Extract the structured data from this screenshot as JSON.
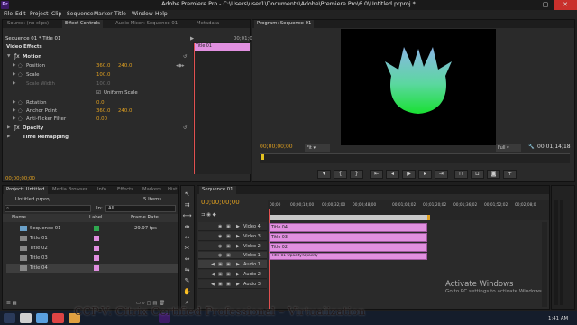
{
  "window": {
    "title": "Adobe Premiere Pro - C:\\Users\\user1\\Documents\\Adobe\\Premiere Pro\\6.0\\Untitled.prproj *"
  },
  "menu": [
    "File",
    "Edit",
    "Project",
    "Clip",
    "Sequence",
    "Marker",
    "Title",
    "Window",
    "Help"
  ],
  "source_panel": {
    "tabs": [
      "Source: (no clips)",
      "Effect Controls",
      "Audio Mixer: Sequence 01",
      "Metadata"
    ],
    "active_tab": "Effect Controls",
    "header": "Sequence 01 * Title 01",
    "ruler_time": "00;01;0",
    "clip_label": "Title 01",
    "video_effects": "Video Effects",
    "motion": "Motion",
    "position": {
      "label": "Position",
      "x": "360.0",
      "y": "240.0"
    },
    "scale": {
      "label": "Scale",
      "value": "100.0"
    },
    "scale_width": {
      "label": "Scale Width",
      "value": "100.0"
    },
    "uniform_scale": "Uniform Scale",
    "rotation": {
      "label": "Rotation",
      "value": "0.0"
    },
    "anchor_point": {
      "label": "Anchor Point",
      "x": "360.0",
      "y": "240.0"
    },
    "anti_flicker": {
      "label": "Anti-flicker Filter",
      "value": "0.00"
    },
    "opacity": "Opacity",
    "time_remapping": "Time Remapping",
    "timecode": "00;00;00;00"
  },
  "program": {
    "tab": "Program: Sequence 01",
    "timecode_left": "00;00;00;00",
    "fit": "Fit",
    "full": "Full",
    "timecode_right": "00;01;14;18"
  },
  "project": {
    "tabs": [
      "Project: Untitled",
      "Media Browser",
      "Info",
      "Effects",
      "Markers",
      "Hist"
    ],
    "file": "Untitled.prproj",
    "items_count": "5 Items",
    "in_label": "In:",
    "in_value": "All",
    "columns": [
      "Name",
      "Label",
      "Frame Rate"
    ],
    "rows": [
      {
        "name": "Sequence 01",
        "label_color": "#2fa84f",
        "frame_rate": "29.97 fps"
      },
      {
        "name": "Title 01",
        "label_color": "#e08ee0",
        "frame_rate": ""
      },
      {
        "name": "Title 02",
        "label_color": "#e08ee0",
        "frame_rate": ""
      },
      {
        "name": "Title 03",
        "label_color": "#e08ee0",
        "frame_rate": ""
      },
      {
        "name": "Title 04",
        "label_color": "#e08ee0",
        "frame_rate": ""
      }
    ]
  },
  "timeline": {
    "tab": "Sequence 01",
    "timecode": "00;00;00;00",
    "ruler": [
      "00;00",
      "00;00;16;00",
      "00;00;32;00",
      "00;00;48;00",
      "00;01;04;02",
      "00;01;20;02",
      "00;01;36;02",
      "00;01;52;02",
      "00;02;08;0"
    ],
    "video_tracks": [
      "Video 4",
      "Video 3",
      "Video 2",
      "Video 1"
    ],
    "audio_tracks": [
      "Audio 1",
      "Audio 2",
      "Audio 3"
    ],
    "clips": [
      "Title 04",
      "Title 03",
      "Title 02",
      "Title 01  Opacity:Opacity"
    ]
  },
  "watermark": {
    "title": "Activate Windows",
    "subtitle": "Go to PC settings to activate Windows."
  },
  "overlay_text": "CCP-V: Citrix Certified Professional – Virtualization",
  "taskbar": {
    "time": "1:41 AM"
  },
  "colors": {
    "accent_value": "#e0a020",
    "clip_pink": "#e190e0",
    "playhead": "#e05050"
  }
}
